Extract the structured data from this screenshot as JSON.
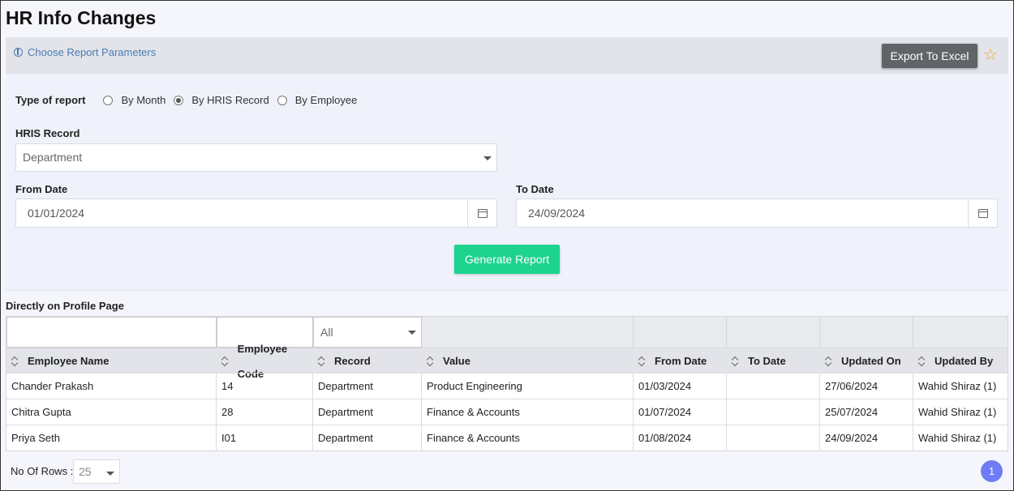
{
  "page": {
    "title": "HR Info Changes"
  },
  "params": {
    "link_label": "Choose Report Parameters",
    "export_label": "Export To Excel",
    "type_label": "Type of report",
    "report_types": [
      {
        "label": "By Month",
        "checked": false
      },
      {
        "label": "By HRIS Record",
        "checked": true
      },
      {
        "label": "By Employee",
        "checked": false
      }
    ],
    "hris_label": "HRIS Record",
    "hris_value": "Department",
    "from_label": "From Date",
    "from_value": "01/01/2024",
    "to_label": "To Date",
    "to_value": "24/09/2024",
    "generate_label": "Generate Report"
  },
  "grid": {
    "section_title": "Directly on Profile Page",
    "record_filter": "All",
    "columns": [
      "Employee Name",
      "Employee Code",
      "Record",
      "Value",
      "From Date",
      "To Date",
      "Updated On",
      "Updated By"
    ],
    "rows": [
      [
        "Chander Prakash",
        "14",
        "Department",
        "Product Engineering",
        "01/03/2024",
        "",
        "27/06/2024",
        "Wahid Shiraz (1)"
      ],
      [
        "Chitra Gupta",
        "28",
        "Department",
        "Finance & Accounts",
        "01/07/2024",
        "",
        "25/07/2024",
        "Wahid Shiraz (1)"
      ],
      [
        "Priya Seth",
        "I01",
        "Department",
        "Finance & Accounts",
        "01/08/2024",
        "",
        "24/09/2024",
        "Wahid Shiraz (1)"
      ]
    ]
  },
  "footer": {
    "rows_label": "No Of Rows :",
    "rows_value": "25",
    "current_page": "1"
  },
  "colors": {
    "export": "#5f6469",
    "generate": "#1dd38e",
    "page": "#6f7cf5",
    "star": "#f5a623"
  }
}
